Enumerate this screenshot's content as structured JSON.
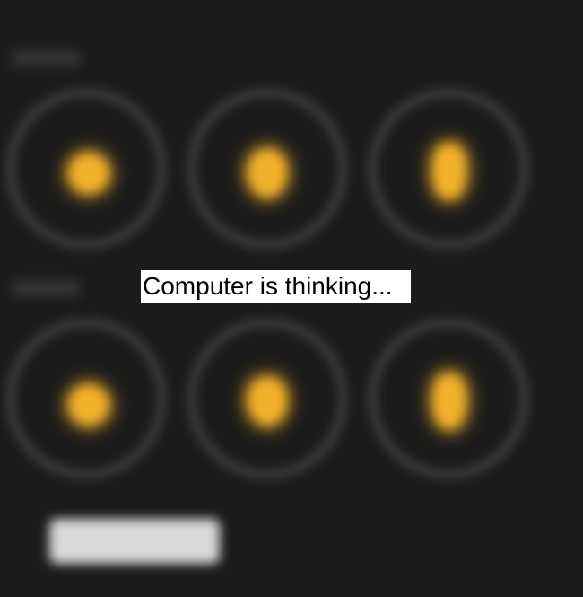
{
  "status": {
    "message": "Computer is thinking..."
  },
  "rows": [
    {
      "slots": [
        {
          "icon": "round-piece-icon"
        },
        {
          "icon": "pawn-piece-icon"
        },
        {
          "icon": "tall-piece-icon"
        }
      ]
    },
    {
      "slots": [
        {
          "icon": "round-piece-icon"
        },
        {
          "icon": "pawn-piece-icon"
        },
        {
          "icon": "tall-piece-icon"
        }
      ]
    }
  ],
  "colors": {
    "background": "#1b1b1b",
    "ring": "#4d4d4d",
    "piece": "#f2b12a",
    "button": "#d9d9d9",
    "banner": "#ffffff"
  }
}
